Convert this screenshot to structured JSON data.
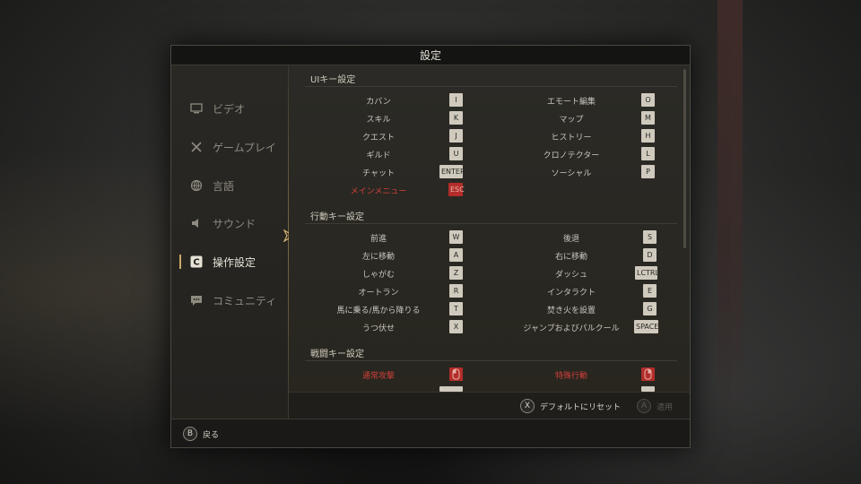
{
  "window": {
    "title": "設定"
  },
  "sidebar": {
    "items": [
      {
        "label": "ビデオ",
        "icon": "monitor-icon"
      },
      {
        "label": "ゲームプレイ",
        "icon": "crossed-swords-icon"
      },
      {
        "label": "言語",
        "icon": "globe-icon"
      },
      {
        "label": "サウンド",
        "icon": "speaker-icon"
      },
      {
        "label": "操作設定",
        "icon": "controls-c-icon",
        "active": true
      },
      {
        "label": "コミュニティ",
        "icon": "chat-bubble-icon"
      }
    ]
  },
  "sections": {
    "ui": {
      "title": "UIキー設定",
      "rows": [
        {
          "left_label": "カバン",
          "left_key": "I",
          "right_label": "エモート編集",
          "right_key": "O"
        },
        {
          "left_label": "スキル",
          "left_key": "K",
          "right_label": "マップ",
          "right_key": "M"
        },
        {
          "left_label": "クエスト",
          "left_key": "J",
          "right_label": "ヒストリー",
          "right_key": "H"
        },
        {
          "left_label": "ギルド",
          "left_key": "U",
          "right_label": "クロノテクター",
          "right_key": "L"
        },
        {
          "left_label": "チャット",
          "left_key": "ENTER",
          "right_label": "ソーシャル",
          "right_key": "P"
        },
        {
          "left_label": "メインメニュー",
          "left_key": "ESC",
          "right_label": "",
          "right_key": ""
        }
      ]
    },
    "movement": {
      "title": "行動キー設定",
      "rows": [
        {
          "left_label": "前進",
          "left_key": "W",
          "right_label": "後退",
          "right_key": "S"
        },
        {
          "left_label": "左に移動",
          "left_key": "A",
          "right_label": "右に移動",
          "right_key": "D"
        },
        {
          "left_label": "しゃがむ",
          "left_key": "Z",
          "right_label": "ダッシュ",
          "right_key": "LCTRL"
        },
        {
          "left_label": "オートラン",
          "left_key": "R",
          "right_label": "インタラクト",
          "right_key": "E"
        },
        {
          "left_label": "馬に乗る/馬から降りる",
          "left_key": "T",
          "right_label": "焚き火を設置",
          "right_key": "G"
        },
        {
          "left_label": "うつ伏せ",
          "left_key": "X",
          "right_label": "ジャンプおよびパルクール",
          "right_key": "SPACE"
        }
      ]
    },
    "combat": {
      "title": "戦闘キー設定",
      "rows": [
        {
          "left_label": "通常攻撃",
          "left_key": "mouse-left-icon",
          "right_label": "特殊行動",
          "right_key": "mouse-right-icon"
        }
      ]
    }
  },
  "footer": {
    "reset": {
      "button": "X",
      "label": "デフォルトにリセット"
    },
    "apply": {
      "button": "A",
      "label": "適用"
    },
    "back": {
      "button": "B",
      "label": "戻る"
    }
  }
}
